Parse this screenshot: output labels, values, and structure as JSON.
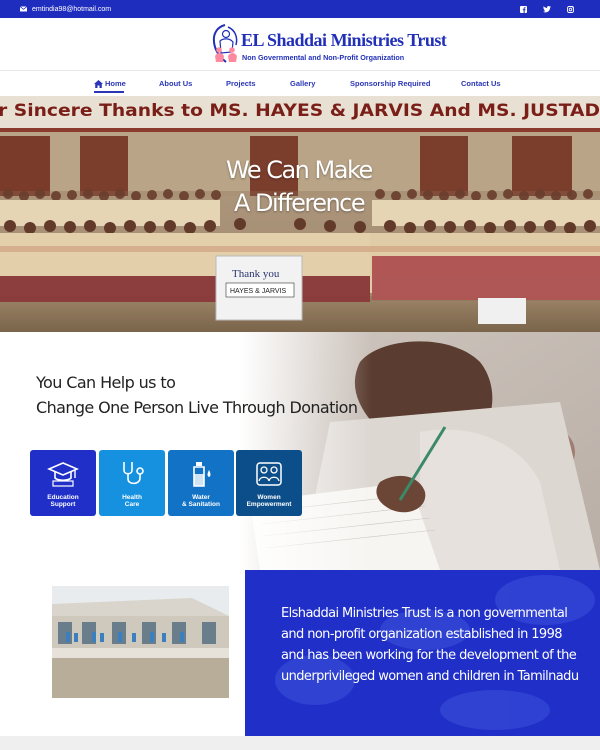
{
  "topbar": {
    "email": "emtindia98@hotmail.com",
    "social_icons": [
      "facebook-icon",
      "twitter-icon",
      "instagram-icon"
    ]
  },
  "header": {
    "logo_title": "EL Shaddai Ministries Trust",
    "logo_subtitle": "Non Governmental and Non-Profit Organization"
  },
  "nav": {
    "items": [
      {
        "label": "Home",
        "active": true
      },
      {
        "label": "About Us"
      },
      {
        "label": "Projects"
      },
      {
        "label": "Gallery"
      },
      {
        "label": "Sponsorship Required"
      },
      {
        "label": "Contact Us"
      }
    ]
  },
  "hero": {
    "line1": "We Can Make",
    "line2": "A Difference",
    "banner_text": "r Sincere Thanks to MS. HAYES & JARVIS And MS. JUSTAD",
    "sign_text_1": "Thank you",
    "sign_text_2": "HAYES & JARVIS"
  },
  "help": {
    "title_line1": "You Can Help us to",
    "title_line2": "Change One Person Live Through Donation",
    "cards": [
      {
        "line1": "Education",
        "line2": "Support",
        "color": "#1f2fc8",
        "icon": "graduation-cap-icon"
      },
      {
        "line1": "Health",
        "line2": "Care",
        "color": "#1591e0",
        "icon": "stethoscope-icon"
      },
      {
        "line1": "Water",
        "line2": "& Sanitation",
        "color": "#1272c6",
        "icon": "water-bottle-icon"
      },
      {
        "line1": "Women",
        "line2": "Empowerment",
        "color": "#0c4e8a",
        "icon": "people-puzzle-icon"
      }
    ]
  },
  "about": {
    "text": "Elshaddai Ministries Trust is a non governmental and non-profit organization established in 1998 and has been working for the development of the underprivileged women and children in Tamilnadu"
  },
  "colors": {
    "brand_blue": "#1f2dbe",
    "nav_text": "#2a36b5"
  }
}
